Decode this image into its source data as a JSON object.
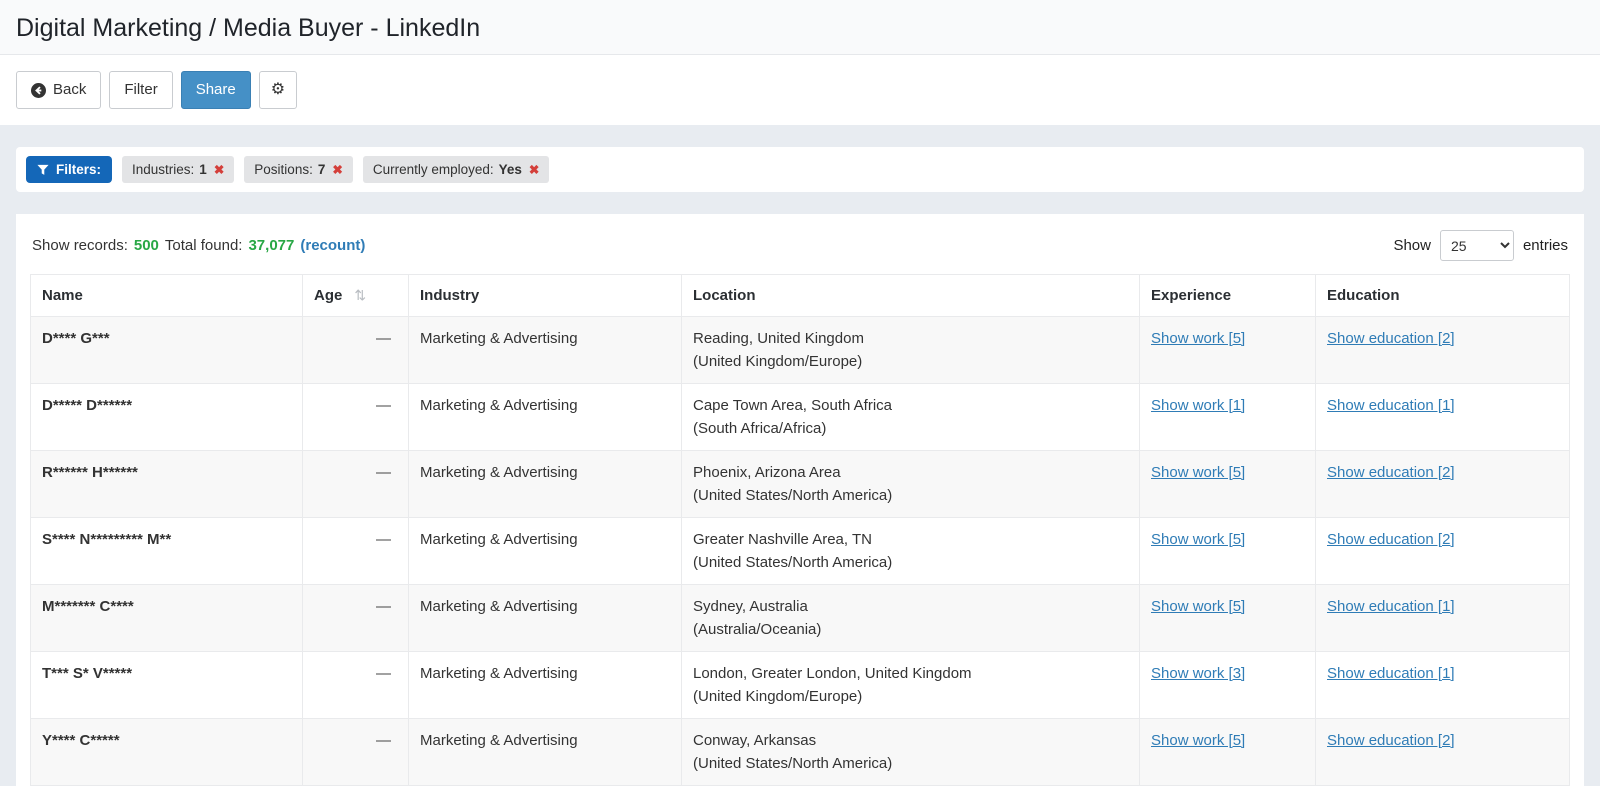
{
  "page": {
    "title": "Digital Marketing / Media Buyer - LinkedIn"
  },
  "toolbar": {
    "back_label": "Back",
    "filter_label": "Filter",
    "share_label": "Share"
  },
  "icons": {
    "gear": "⚙",
    "remove": "✖",
    "sort": "⇅"
  },
  "filters": {
    "label": "Filters:",
    "chips": [
      {
        "label": "Industries:",
        "value": "1"
      },
      {
        "label": "Positions:",
        "value": "7"
      },
      {
        "label": "Currently employed:",
        "value": "Yes"
      }
    ]
  },
  "records": {
    "show_records_label": "Show records:",
    "show_records_value": "500",
    "total_found_label": "Total found:",
    "total_found_value": "37,077",
    "recount_label": "(recount)"
  },
  "pagination": {
    "show_label": "Show",
    "page_size": "25",
    "entries_label": "entries"
  },
  "table": {
    "columns": [
      "Name",
      "Age",
      "Industry",
      "Location",
      "Experience",
      "Education"
    ],
    "rows": [
      {
        "name": "D**** G***",
        "age": "—",
        "industry": "Marketing & Advertising",
        "location1": "Reading, United Kingdom",
        "location2": "(United Kingdom/Europe)",
        "experience": "Show work [5]",
        "education": "Show education [2]"
      },
      {
        "name": "D***** D******",
        "age": "—",
        "industry": "Marketing & Advertising",
        "location1": "Cape Town Area, South Africa",
        "location2": "(South Africa/Africa)",
        "experience": "Show work [1]",
        "education": "Show education [1]"
      },
      {
        "name": "R****** H******",
        "age": "—",
        "industry": "Marketing & Advertising",
        "location1": "Phoenix, Arizona Area",
        "location2": "(United States/North America)",
        "experience": "Show work [5]",
        "education": "Show education [2]"
      },
      {
        "name": "S**** N********* M**",
        "age": "—",
        "industry": "Marketing & Advertising",
        "location1": "Greater Nashville Area, TN",
        "location2": "(United States/North America)",
        "experience": "Show work [5]",
        "education": "Show education [2]"
      },
      {
        "name": "M******* C****",
        "age": "—",
        "industry": "Marketing & Advertising",
        "location1": "Sydney, Australia",
        "location2": "(Australia/Oceania)",
        "experience": "Show work [5]",
        "education": "Show education [1]"
      },
      {
        "name": "T*** S* V*****",
        "age": "—",
        "industry": "Marketing & Advertising",
        "location1": "London, Greater London, United Kingdom",
        "location2": "(United Kingdom/Europe)",
        "experience": "Show work [3]",
        "education": "Show education [1]"
      },
      {
        "name": "Y**** C*****",
        "age": "—",
        "industry": "Marketing & Advertising",
        "location1": "Conway, Arkansas",
        "location2": "(United States/North America)",
        "experience": "Show work [5]",
        "education": "Show education [2]"
      }
    ]
  }
}
